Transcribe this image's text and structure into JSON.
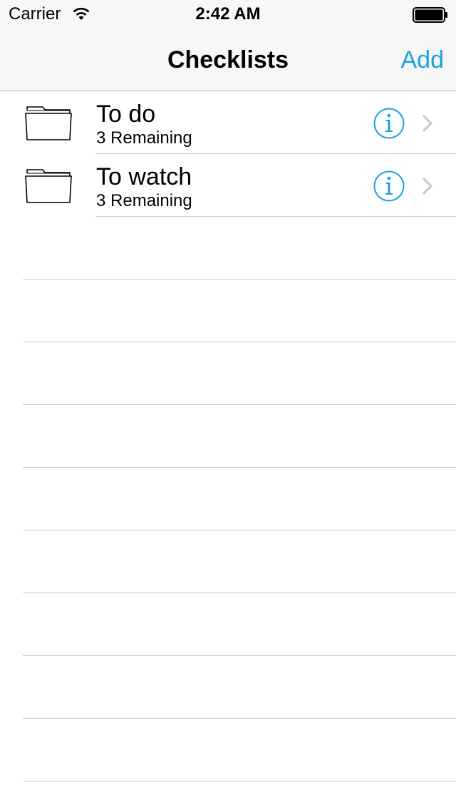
{
  "status_bar": {
    "carrier": "Carrier",
    "time": "2:42 AM",
    "wifi_icon": "wifi-icon",
    "battery_icon": "battery-icon"
  },
  "nav_bar": {
    "title": "Checklists",
    "add_label": "Add",
    "accent_color": "#1aa1e0"
  },
  "checklists": [
    {
      "title": "To do",
      "subtitle": "3 Remaining",
      "icon": "folder-icon"
    },
    {
      "title": "To watch",
      "subtitle": "3 Remaining",
      "icon": "folder-icon"
    }
  ]
}
